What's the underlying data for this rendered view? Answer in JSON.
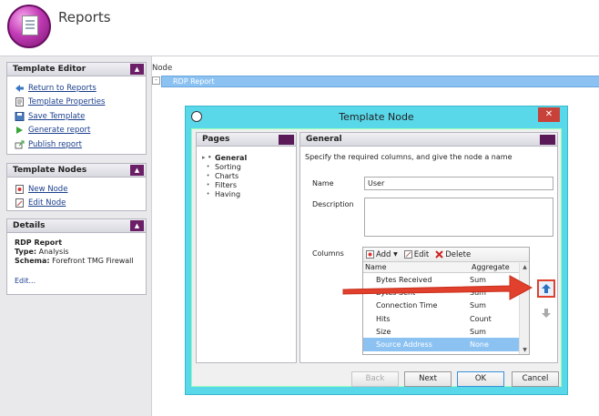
{
  "app": {
    "title": "Reports"
  },
  "sidebar": {
    "template_editor": {
      "title": "Template Editor",
      "items": [
        {
          "label": "Return to Reports",
          "icon": "arrow-left-icon"
        },
        {
          "label": "Template Properties",
          "icon": "properties-icon"
        },
        {
          "label": "Save Template",
          "icon": "save-icon"
        },
        {
          "label": "Generate report",
          "icon": "generate-icon"
        },
        {
          "label": "Publish report",
          "icon": "publish-icon"
        }
      ]
    },
    "template_nodes": {
      "title": "Template Nodes",
      "items": [
        {
          "label": "New Node",
          "icon": "new-node-icon"
        },
        {
          "label": "Edit Node",
          "icon": "edit-node-icon"
        }
      ]
    },
    "details": {
      "title": "Details",
      "name": "RDP Report",
      "type_label": "Type:",
      "type_value": "Analysis",
      "schema_label": "Schema:",
      "schema_value": "Forefront TMG Firewall",
      "edit": "Edit..."
    }
  },
  "main": {
    "node_header": "Node",
    "node_row": "RDP Report"
  },
  "dialog": {
    "title": "Template Node",
    "pages": {
      "title": "Pages",
      "items": [
        "General",
        "Sorting",
        "Charts",
        "Filters",
        "Having"
      ],
      "active": "General"
    },
    "general": {
      "title": "General",
      "instruction": "Specify the required columns, and give the node a name",
      "name_label": "Name",
      "name_value": "User",
      "description_label": "Description",
      "description_value": "",
      "columns_label": "Columns",
      "toolbar": {
        "add": "Add",
        "edit": "Edit",
        "delete": "Delete"
      },
      "col_headers": {
        "name": "Name",
        "aggregate": "Aggregate"
      },
      "rows": [
        {
          "name": "Bytes Received",
          "aggregate": "Sum"
        },
        {
          "name": "Bytes Sent",
          "aggregate": "Sum"
        },
        {
          "name": "Connection Time",
          "aggregate": "Sum"
        },
        {
          "name": "Hits",
          "aggregate": "Count"
        },
        {
          "name": "Size",
          "aggregate": "Sum"
        },
        {
          "name": "Source Address",
          "aggregate": "None"
        }
      ]
    },
    "buttons": {
      "back": "Back",
      "next": "Next",
      "ok": "OK",
      "cancel": "Cancel"
    }
  },
  "colors": {
    "accent": "#6a1f66",
    "selection": "#8cc2f2",
    "dialog_frame": "#59d8ea",
    "annotation": "#e0402c"
  }
}
